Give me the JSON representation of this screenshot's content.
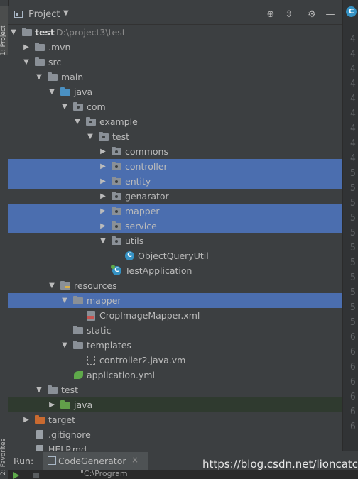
{
  "tool_strip": {
    "project_tab": "1: Project",
    "favorites_tab": "2: Favorites"
  },
  "header": {
    "title": "Project",
    "dropdown_icon": "chevron-down-icon",
    "buttons": [
      "crosshair-icon",
      "collapse-icon",
      "gear-icon",
      "minimize-icon"
    ]
  },
  "tree": {
    "rows": [
      {
        "label": "test",
        "path": "D:\\project3\\test",
        "bold": true
      },
      {
        "label": ".mvn"
      },
      {
        "label": "src"
      },
      {
        "label": "main"
      },
      {
        "label": "java"
      },
      {
        "label": "com"
      },
      {
        "label": "example"
      },
      {
        "label": "test"
      },
      {
        "label": "commons"
      },
      {
        "label": "controller"
      },
      {
        "label": "entity"
      },
      {
        "label": "genarator"
      },
      {
        "label": "mapper"
      },
      {
        "label": "service"
      },
      {
        "label": "utils"
      },
      {
        "label": "ObjectQueryUtil",
        "icon_letter": "C"
      },
      {
        "label": "TestApplication",
        "icon_letter": "C"
      },
      {
        "label": "resources"
      },
      {
        "label": "mapper"
      },
      {
        "label": "CropImageMapper.xml"
      },
      {
        "label": "static"
      },
      {
        "label": "templates"
      },
      {
        "label": "controller2.java.vm"
      },
      {
        "label": "application.yml"
      },
      {
        "label": "test"
      },
      {
        "label": "java"
      },
      {
        "label": "target"
      },
      {
        "label": ".gitignore"
      },
      {
        "label": "HELP.md"
      }
    ],
    "selection_color": "#4b6eaf"
  },
  "editor_gutter": {
    "tab_icon_letter": "C",
    "line_numbers": [
      "4",
      "4",
      "4",
      "4",
      "4",
      "4",
      "4",
      "4",
      "4",
      "5",
      "5",
      "5",
      "5",
      "5",
      "5",
      "5",
      "5",
      "5",
      "5",
      "5",
      "6",
      "6",
      "6",
      "6",
      "6",
      "6",
      "6"
    ]
  },
  "run_bar": {
    "label": "Run:",
    "tab_name": "CodeGenerator",
    "close_glyph": "×",
    "command_text": "\"C:\\Program"
  },
  "watermark": "https://blog.csdn.net/lioncatch"
}
